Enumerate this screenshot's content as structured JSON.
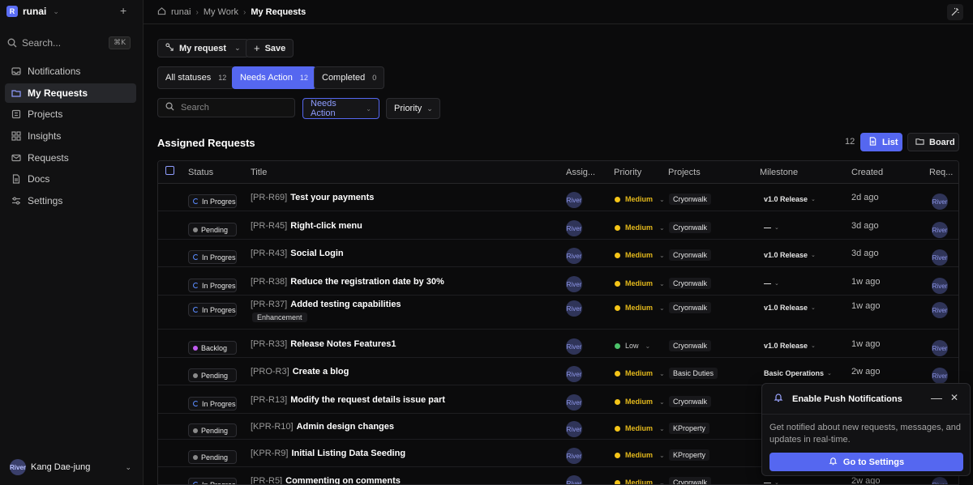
{
  "workspace": {
    "logo": "R",
    "name": "runai"
  },
  "sidebar": {
    "search_label": "Search...",
    "search_shortcut": "⌘K",
    "items": [
      {
        "label": "Notifications",
        "icon": "inbox-icon"
      },
      {
        "label": "My Requests",
        "icon": "folder-icon",
        "active": true
      },
      {
        "label": "Projects",
        "icon": "projects-icon"
      },
      {
        "label": "Insights",
        "icon": "grid-icon"
      },
      {
        "label": "Requests",
        "icon": "mail-icon"
      },
      {
        "label": "Docs",
        "icon": "doc-icon"
      },
      {
        "label": "Settings",
        "icon": "settings-icon"
      }
    ],
    "user": {
      "avatar": "River",
      "name": "Kang Dae-jung"
    }
  },
  "breadcrumb": {
    "root": "runai",
    "parent": "My Work",
    "current": "My Requests"
  },
  "toolbar": {
    "view_label": "My request",
    "save_label": "Save"
  },
  "status_tabs": [
    {
      "label": "All statuses",
      "count": "12"
    },
    {
      "label": "Needs Action",
      "count": "12",
      "active": true
    },
    {
      "label": "Completed",
      "count": "0"
    }
  ],
  "filters": {
    "search_placeholder": "Search",
    "status_filter": "Needs Action",
    "priority_filter": "Priority"
  },
  "section": {
    "title": "Assigned Requests",
    "count": "12",
    "list_label": "List",
    "board_label": "Board"
  },
  "table": {
    "headers": {
      "status": "Status",
      "title": "Title",
      "assignee": "Assig...",
      "priority": "Priority",
      "projects": "Projects",
      "milestone": "Milestone",
      "created": "Created",
      "requester": "Req..."
    },
    "rows": [
      {
        "status": "In Progress",
        "status_kind": "progress",
        "code": "[PR-R69]",
        "title": "Test your payments",
        "assignee": "River",
        "priority": "Medium",
        "project": "Cryonwalk",
        "milestone": "v1.0 Release",
        "created": "2d ago",
        "requester": "River"
      },
      {
        "status": "Pending",
        "status_kind": "pending",
        "code": "[PR-R45]",
        "title": "Right-click menu",
        "assignee": "River",
        "priority": "Medium",
        "project": "Cryonwalk",
        "milestone": "—",
        "created": "3d ago",
        "requester": "River"
      },
      {
        "status": "In Progress",
        "status_kind": "progress",
        "code": "[PR-R43]",
        "title": "Social Login",
        "assignee": "River",
        "priority": "Medium",
        "project": "Cryonwalk",
        "milestone": "v1.0 Release",
        "created": "3d ago",
        "requester": "River"
      },
      {
        "status": "In Progress",
        "status_kind": "progress",
        "code": "[PR-R38]",
        "title": "Reduce the registration date by 30%",
        "assignee": "River",
        "priority": "Medium",
        "project": "Cryonwalk",
        "milestone": "—",
        "created": "1w ago",
        "requester": "River"
      },
      {
        "status": "In Progress",
        "status_kind": "progress",
        "code": "[PR-R37]",
        "title": "Added testing capabilities",
        "tag": "Enhancement",
        "assignee": "River",
        "priority": "Medium",
        "project": "Cryonwalk",
        "milestone": "v1.0 Release",
        "created": "1w ago",
        "requester": "River"
      },
      {
        "status": "Backlog",
        "status_kind": "backlog",
        "code": "[PR-R33]",
        "title": "Release Notes Features1",
        "assignee": "River",
        "priority": "Low",
        "project": "Cryonwalk",
        "milestone": "v1.0 Release",
        "created": "1w ago",
        "requester": "River"
      },
      {
        "status": "Pending",
        "status_kind": "pending",
        "code": "[PRO-R3]",
        "title": "Create a blog",
        "assignee": "River",
        "priority": "Medium",
        "project": "Basic Duties",
        "milestone": "Basic Operations",
        "created": "2w ago",
        "requester": "River"
      },
      {
        "status": "In Progress",
        "status_kind": "progress",
        "code": "[PR-R13]",
        "title": "Modify the request details issue part",
        "assignee": "River",
        "priority": "Medium",
        "project": "Cryonwalk",
        "milestone": "",
        "created": "",
        "requester": ""
      },
      {
        "status": "Pending",
        "status_kind": "pending",
        "code": "[KPR-R10]",
        "title": "Admin design changes",
        "assignee": "River",
        "priority": "Medium",
        "project": "KProperty",
        "milestone": "",
        "created": "",
        "requester": ""
      },
      {
        "status": "Pending",
        "status_kind": "pending",
        "code": "[KPR-R9]",
        "title": "Initial Listing Data Seeding",
        "assignee": "River",
        "priority": "Medium",
        "project": "KProperty",
        "milestone": "",
        "created": "",
        "requester": ""
      },
      {
        "status": "In Progress",
        "status_kind": "progress",
        "code": "[PR-R5]",
        "title": "Commenting on comments",
        "assignee": "River",
        "priority": "Medium",
        "project": "Cryonwalk",
        "milestone": "—",
        "created": "2w ago",
        "requester": "River"
      }
    ]
  },
  "toast": {
    "title": "Enable Push Notifications",
    "body": "Get notified about new requests, messages, and updates in real-time.",
    "button": "Go to Settings"
  },
  "colors": {
    "accent": "#5567f0",
    "medium": "#f5c518",
    "low": "#4cc36a",
    "backlog": "#c05cf0",
    "pending": "#8a8a8a",
    "progress": "#5b8cff"
  }
}
